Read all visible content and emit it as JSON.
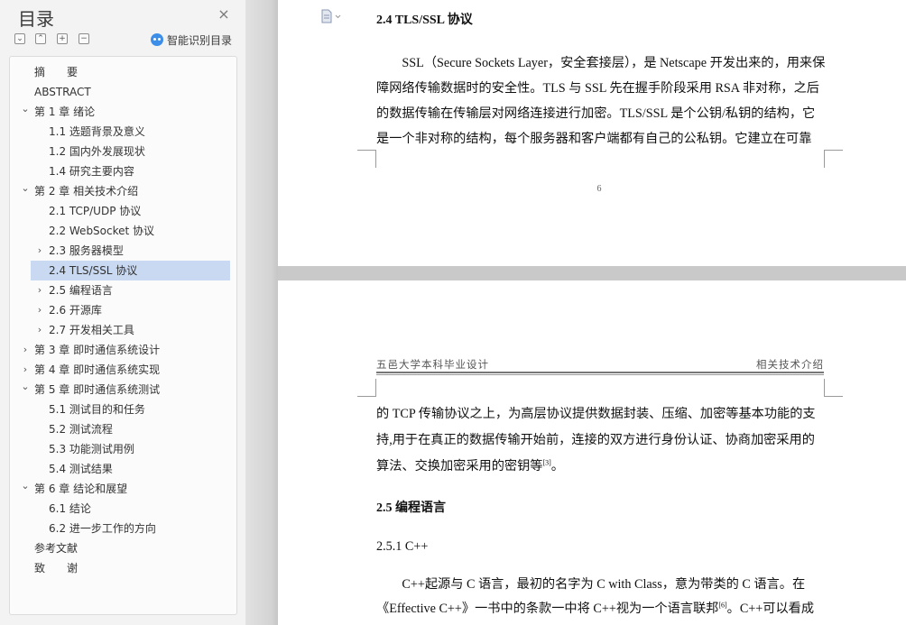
{
  "sidebar": {
    "title": "目录",
    "close_icon": "×",
    "toolbar": {
      "collapse_all": "⌄",
      "expand_all": "⌃",
      "add": "+",
      "remove": "−"
    },
    "smart_toc_label": "智能识别目录",
    "items": [
      {
        "label": "摘　　要",
        "level": 0,
        "chevron": ""
      },
      {
        "label": "ABSTRACT",
        "level": 0,
        "chevron": ""
      },
      {
        "label": "第 1 章  绪论",
        "level": 0,
        "chevron": "⌄"
      },
      {
        "label": "1.1  选题背景及意义",
        "level": 1,
        "chevron": ""
      },
      {
        "label": "1.2  国内外发展现状",
        "level": 1,
        "chevron": ""
      },
      {
        "label": "1.4  研究主要内容",
        "level": 1,
        "chevron": ""
      },
      {
        "label": "第 2 章  相关技术介绍",
        "level": 0,
        "chevron": "⌄"
      },
      {
        "label": "2.1 TCP/UDP 协议",
        "level": 1,
        "chevron": ""
      },
      {
        "label": "2.2 WebSocket 协议",
        "level": 1,
        "chevron": ""
      },
      {
        "label": "2.3  服务器模型",
        "level": 1,
        "chevron": "›"
      },
      {
        "label": "2.4 TLS/SSL 协议",
        "level": 1,
        "chevron": "",
        "selected": true
      },
      {
        "label": "2.5 编程语言",
        "level": 1,
        "chevron": "›"
      },
      {
        "label": "2.6  开源库",
        "level": 1,
        "chevron": "›"
      },
      {
        "label": "2.7  开发相关工具",
        "level": 1,
        "chevron": "›"
      },
      {
        "label": "第 3 章  即时通信系统设计",
        "level": 0,
        "chevron": "›"
      },
      {
        "label": "第 4 章  即时通信系统实现",
        "level": 0,
        "chevron": "›"
      },
      {
        "label": "第 5 章  即时通信系统测试",
        "level": 0,
        "chevron": "⌄"
      },
      {
        "label": "5.1 测试目的和任务",
        "level": 1,
        "chevron": ""
      },
      {
        "label": "5.2 测试流程",
        "level": 1,
        "chevron": ""
      },
      {
        "label": "5.3  功能测试用例",
        "level": 1,
        "chevron": ""
      },
      {
        "label": "5.4  测试结果",
        "level": 1,
        "chevron": ""
      },
      {
        "label": "第 6 章  结论和展望",
        "level": 0,
        "chevron": "⌄"
      },
      {
        "label": "6.1  结论",
        "level": 1,
        "chevron": ""
      },
      {
        "label": "6.2  进一步工作的方向",
        "level": 1,
        "chevron": ""
      },
      {
        "label": "参考文献",
        "level": 0,
        "chevron": ""
      },
      {
        "label": "致　　谢",
        "level": 0,
        "chevron": ""
      }
    ]
  },
  "document": {
    "page1": {
      "heading": "2.4 TLS/SSL 协议",
      "lines": [
        "　　SSL（Secure Sockets Layer，安全套接层），是 Netscape 开发出来的，用来保",
        "障网络传输数据时的安全性。TLS 与 SSL 先在握手阶段采用 RSA 非对称，之后",
        "的数据传输在传输层对网络连接进行加密。TLS/SSL 是个公钥/私钥的结构，它",
        "是一个非对称的结构，每个服务器和客户端都有自己的公私钥。它建立在可靠"
      ],
      "page_number": "6"
    },
    "page2": {
      "header_left": "五邑大学本科毕业设计",
      "header_right": "相关技术介绍",
      "para1_lines": [
        "的 TCP 传输协议之上，为高层协议提供数据封装、压缩、加密等基本功能的支",
        "持,用于在真正的数据传输开始前，连接的双方进行身份认证、协商加密采用的",
        "算法、交换加密采用的密钥等"
      ],
      "para1_ref": "[3]",
      "para1_end": "。",
      "heading_25": "2.5 编程语言",
      "heading_251": "2.5.1 C++",
      "para2_line1": "　　C++起源与 C 语言，最初的名字为 C with Class，意为带类的 C 语言。在",
      "para2_line2_start": "《Effective C++》一书中的条款一中将 C++视为一个语言联邦",
      "para2_ref": "[6]",
      "para2_line2_end": "。C++可以看成"
    }
  },
  "colors": {
    "sidebar_bg": "#f3f3f3",
    "selected_item": "#c9d9f1",
    "smart_icon": "#3d8ee8",
    "page_gap": "#c9c9c9"
  },
  "icons": [
    "close-icon",
    "collapse-all-icon",
    "expand-all-icon",
    "add-icon",
    "remove-icon",
    "smart-toc-icon",
    "document-icon",
    "chevron-down-icon",
    "chevron-right-icon"
  ]
}
